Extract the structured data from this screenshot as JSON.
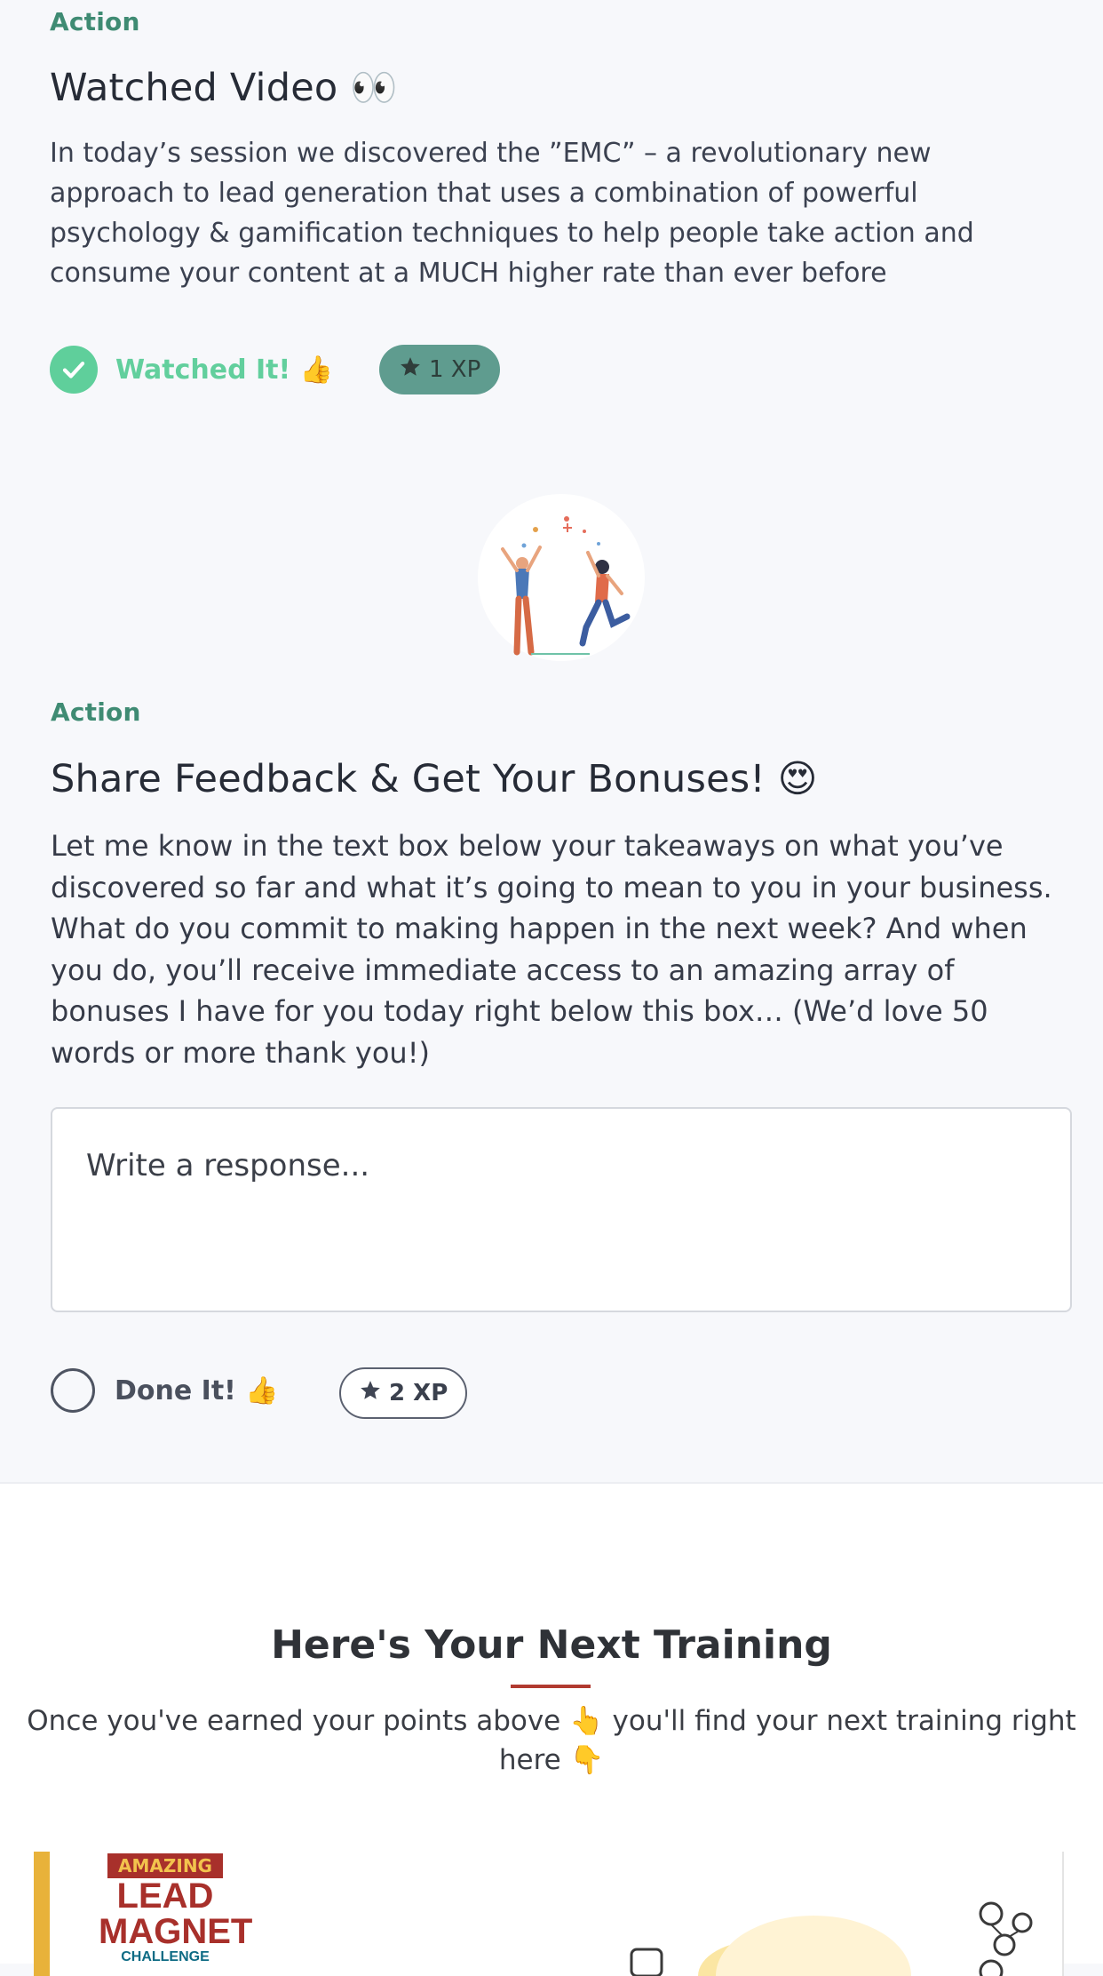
{
  "action1": {
    "label": "Action",
    "title": "Watched Video 👀",
    "description": "In today’s session we discovered the ”EMC” – a revolutionary new approach to lead generation that uses a combination of powerful psychology & gamification techniques to help people take action and consume your content at a MUCH higher rate than ever before",
    "status_label": "Watched It! 👍",
    "xp": "1 XP",
    "completed": true
  },
  "action2": {
    "label": "Action",
    "title": "Share Feedback & Get Your Bonuses! 😍",
    "description": "Let me know in the text box below your takeaways on what you’ve discovered so far and what it’s going to mean to you in your business. What do you commit to making happen in the next week? And when you do, you’ll receive immediate access to an amazing array of bonuses I have for you today right below this box… (We’d love 50 words or more thank you!)",
    "response_placeholder": "Write a response...",
    "response_value": "",
    "status_label": "Done It! 👍",
    "xp": "2 XP",
    "completed": false
  },
  "next_training": {
    "title": "Here's Your Next Training",
    "subtitle_line1": "Once you've earned your points above 👆 you'll find your next training right",
    "subtitle_line2": "here 👇"
  },
  "card": {
    "logo_top": "AMAZING",
    "logo_line1": "LEAD",
    "logo_line2": "MAGNET",
    "logo_line3": "CHALLENGE"
  },
  "icons": {
    "check": "check-icon",
    "star": "star-icon",
    "celebration": "celebration-illustration"
  },
  "colors": {
    "accent_green": "#3f8b73",
    "check_green": "#5fcf9b",
    "xp_filled": "#5f9c8f",
    "underline_red": "#b13a30",
    "card_accent": "#e8b23a"
  }
}
